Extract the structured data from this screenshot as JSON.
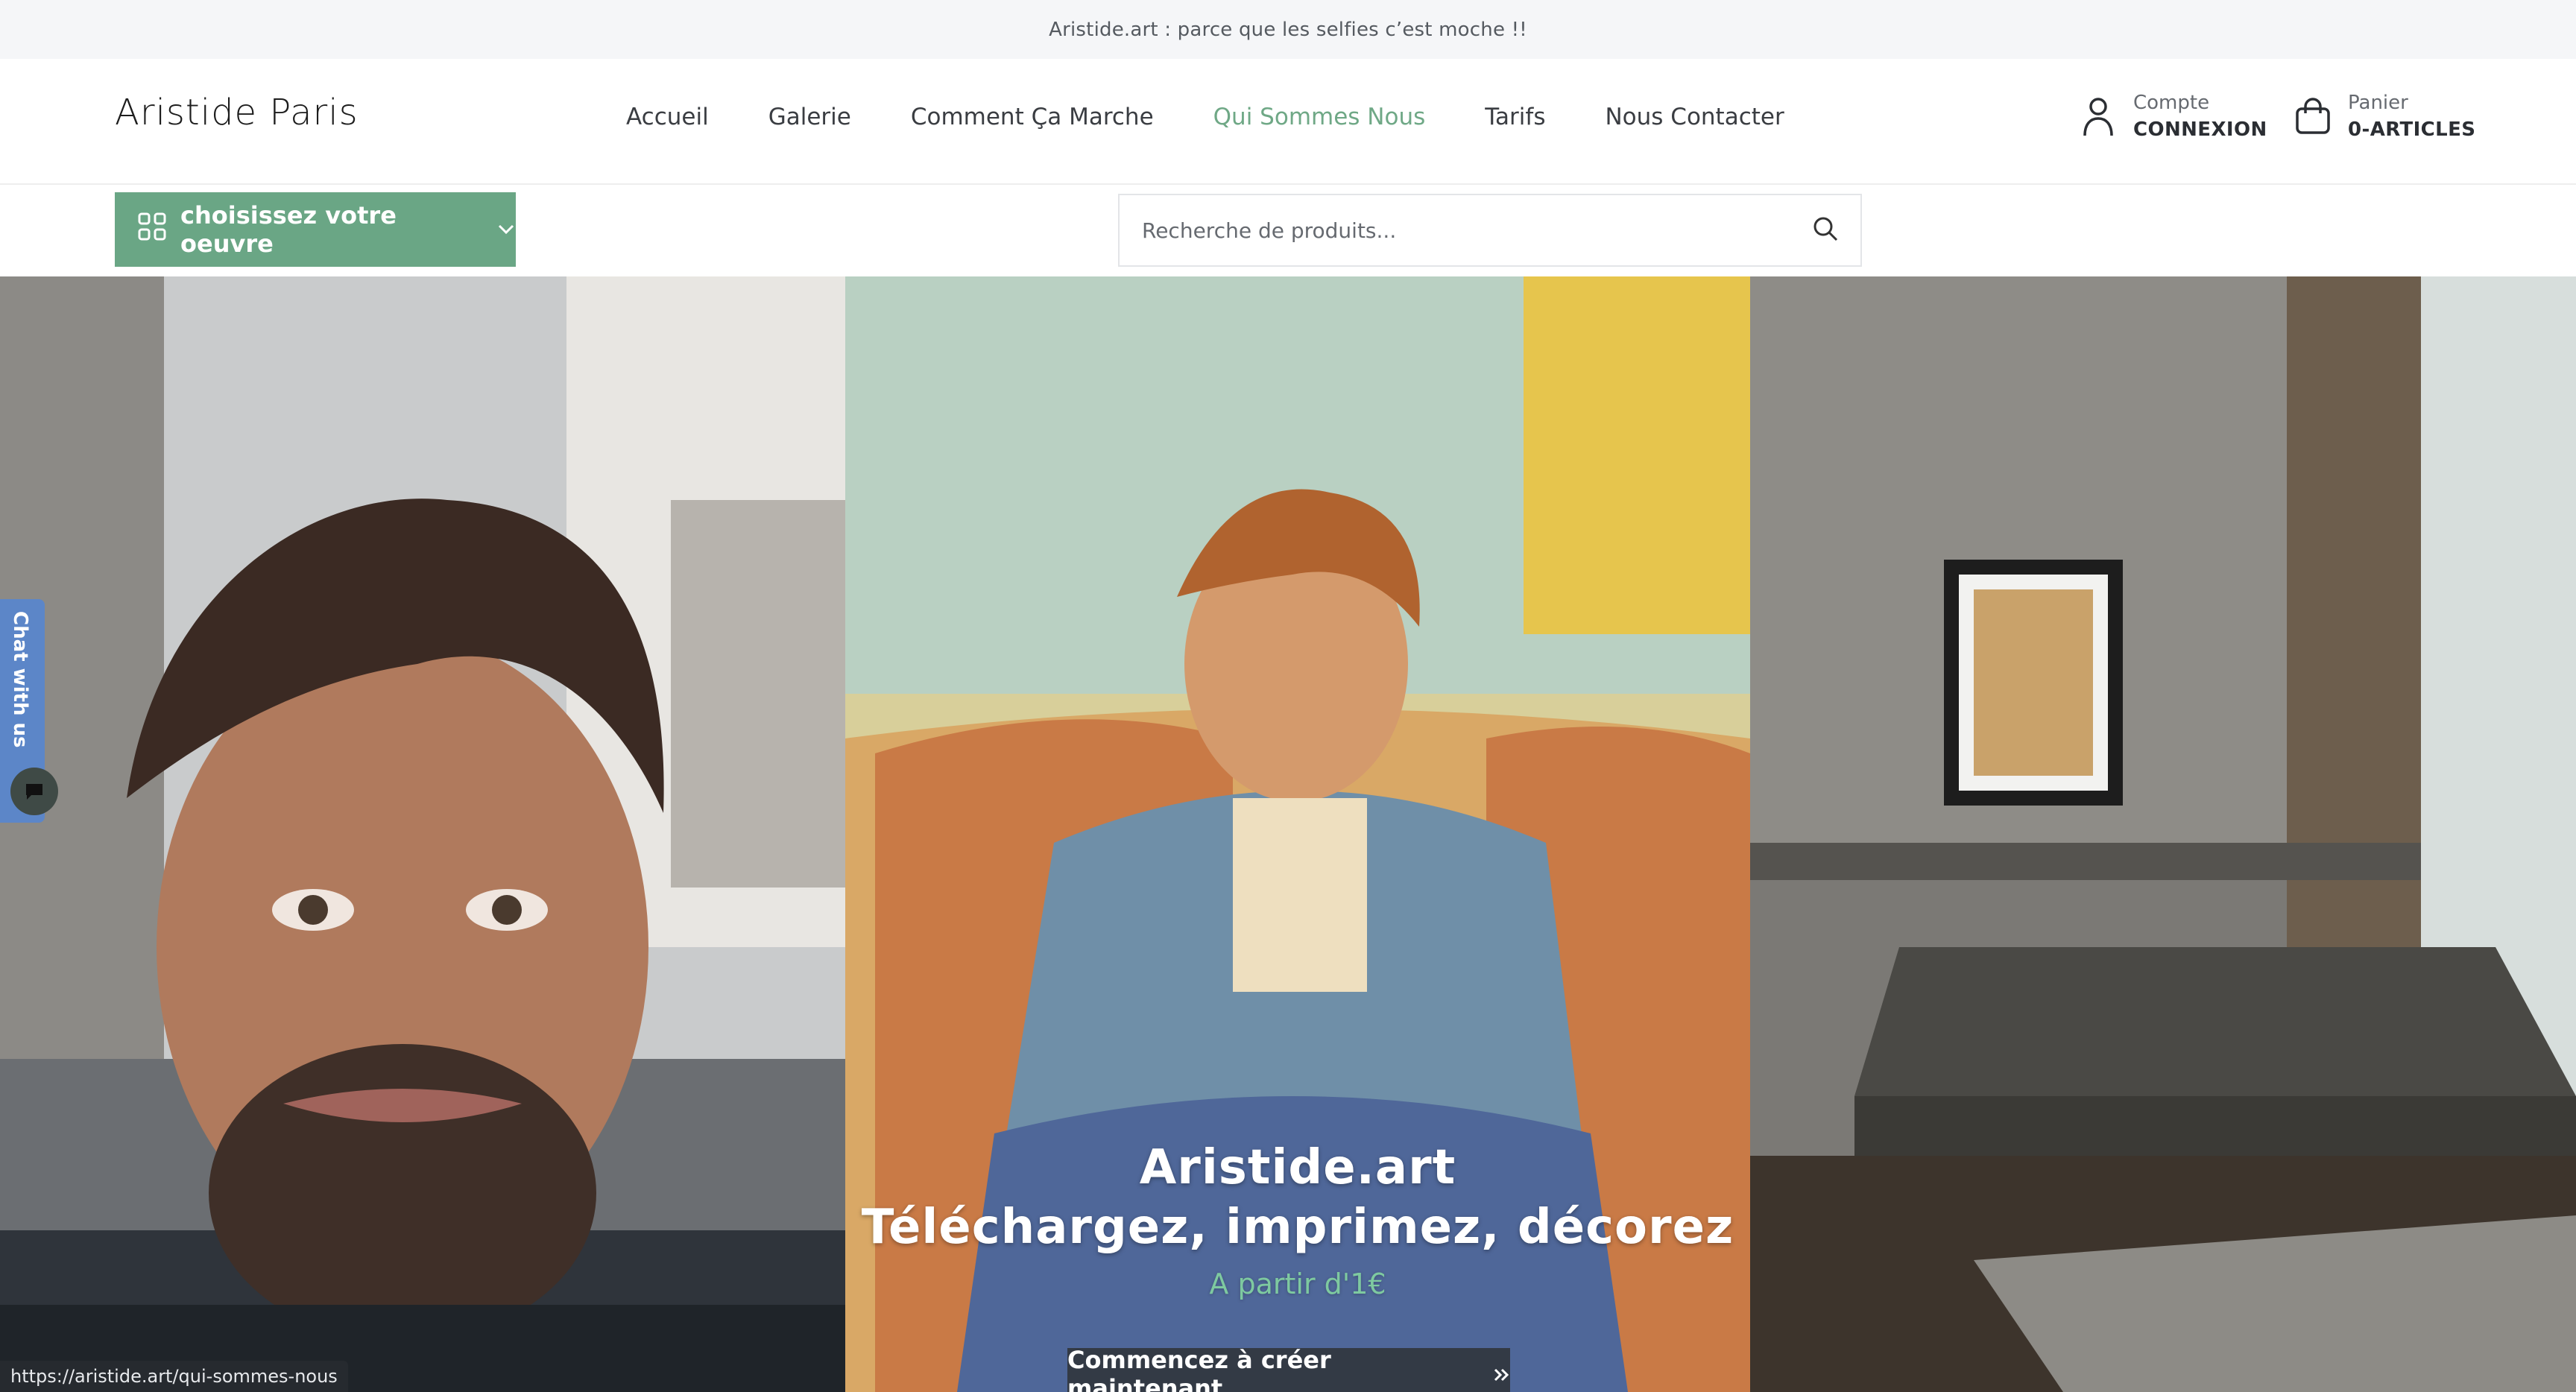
{
  "announcement": "Aristide.art : parce que les selfies c’est moche !!",
  "header": {
    "logo": "Aristide Paris",
    "nav": [
      {
        "label": "Accueil"
      },
      {
        "label": "Galerie"
      },
      {
        "label": "Comment Ça Marche"
      },
      {
        "label": "Qui Sommes Nous"
      },
      {
        "label": "Tarifs"
      },
      {
        "label": "Nous Contacter"
      }
    ],
    "account": {
      "label": "Compte",
      "value": "CONNEXION"
    },
    "cart": {
      "label": "Panier",
      "count": "0",
      "value": "-ARTICLES"
    }
  },
  "category": {
    "label": "choisissez votre oeuvre"
  },
  "search": {
    "placeholder": "Recherche de produits..."
  },
  "hero": {
    "title_line1": "Aristide.art",
    "title_line2": "Téléchargez, imprimez, décorez",
    "subtitle": "A partir d'1€",
    "cta": "Commencez à créer maintenant"
  },
  "chat": {
    "label": "Chat with us"
  },
  "status_url": "https://aristide.art/qui-sommes-nous",
  "colors": {
    "accent": "#6aa685",
    "active_nav": "#6fa886",
    "cta_bg": "#333a45",
    "chat_tab": "#5c86c8"
  }
}
